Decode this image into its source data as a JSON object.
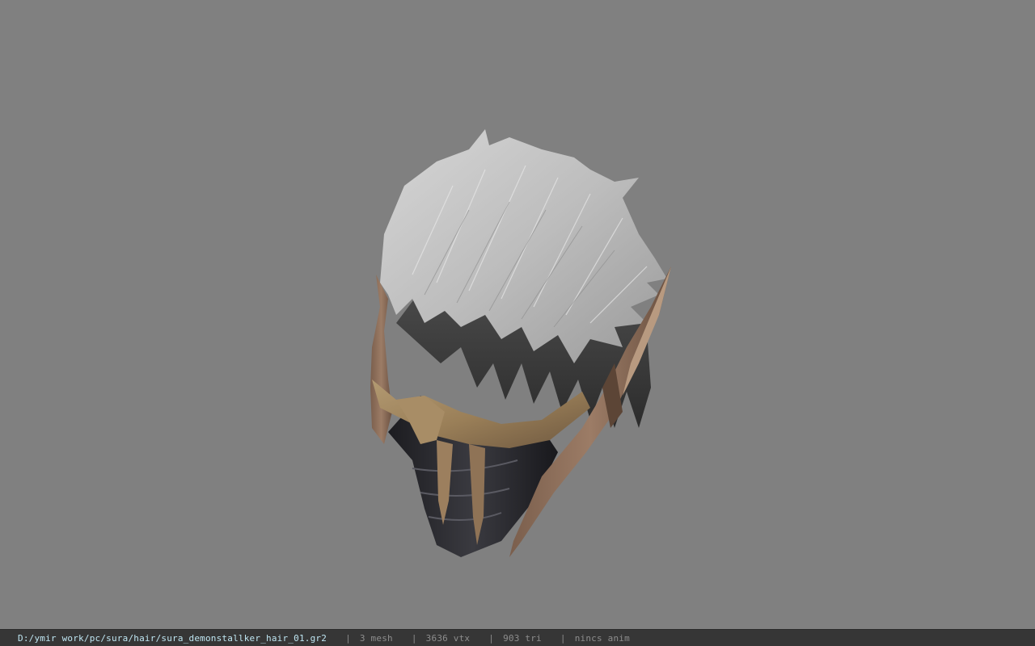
{
  "viewer": {
    "background_color": "#808080",
    "model_icon": "hair-mask-model-icon"
  },
  "status_bar": {
    "file_path": "D:/ymir work/pc/sura/hair/sura_demonstallker_hair_01.gr2",
    "separator": "|",
    "mesh_count": "3 mesh",
    "vertex_count": "3636 vtx",
    "triangle_count": "903 tri",
    "animation": "nincs anim"
  }
}
